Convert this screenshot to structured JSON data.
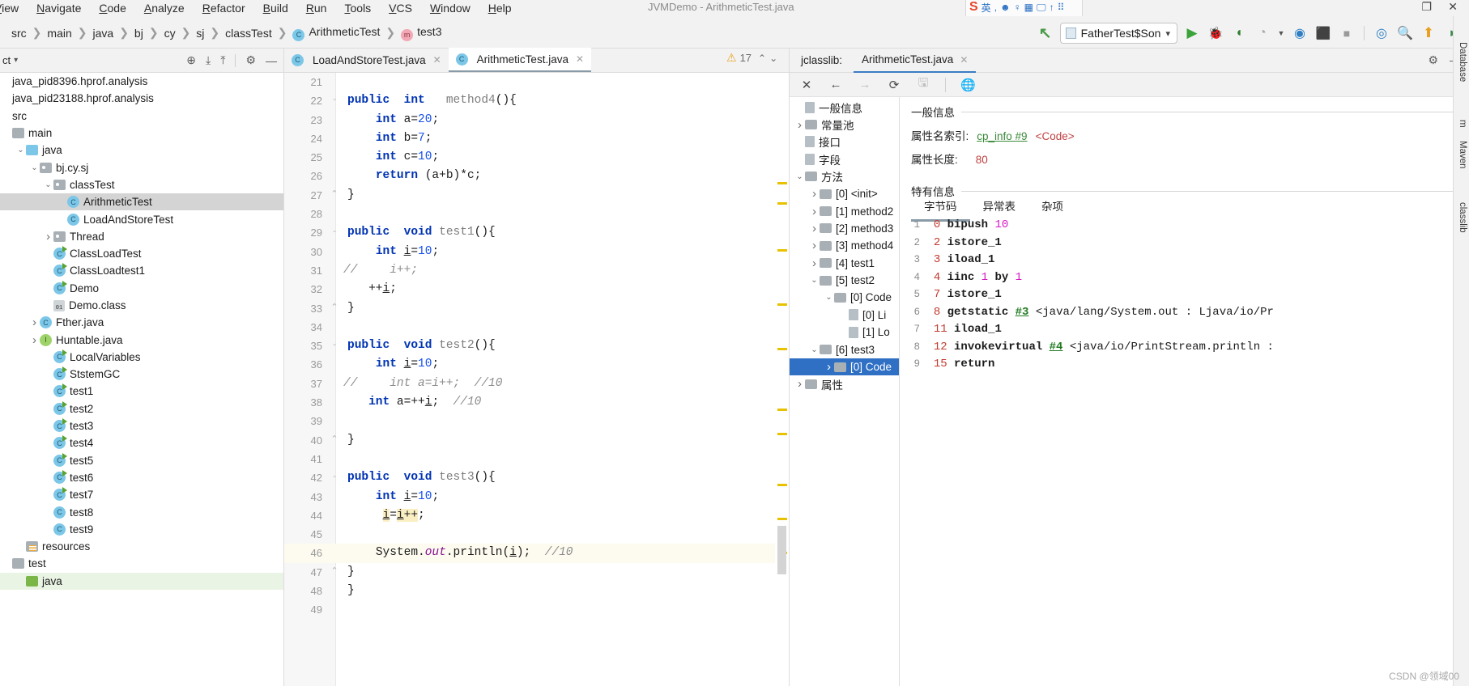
{
  "window": {
    "title": "JVMDemo - ArithmeticTest.java"
  },
  "menubar": {
    "items": [
      "View",
      "Navigate",
      "Code",
      "Analyze",
      "Refactor",
      "Build",
      "Run",
      "Tools",
      "VCS",
      "Window",
      "Help"
    ]
  },
  "ime": {
    "logo": "S",
    "items": [
      "英",
      ",",
      "◐",
      "♀",
      "▦",
      "🖵",
      "↑",
      "⠿"
    ]
  },
  "window_buttons": {
    "restore": "❐",
    "close": "✕"
  },
  "breadcrumb": {
    "items": [
      {
        "label": "src",
        "icon": null
      },
      {
        "label": "main",
        "icon": null
      },
      {
        "label": "java",
        "icon": null
      },
      {
        "label": "bj",
        "icon": null
      },
      {
        "label": "cy",
        "icon": null
      },
      {
        "label": "sj",
        "icon": null
      },
      {
        "label": "classTest",
        "icon": null
      },
      {
        "label": "ArithmeticTest",
        "icon": "class-icon",
        "icon_letter": "C"
      },
      {
        "label": "test3",
        "icon": "method-icon",
        "icon_letter": "m"
      }
    ],
    "separator": "❯"
  },
  "toolbar": {
    "back_label": "↖",
    "run_config": "FatherTest$Son",
    "dropdown_caret": "▾",
    "buttons": [
      {
        "name": "run-button",
        "glyph": "▶",
        "color": "#3aa33a"
      },
      {
        "name": "debug-button",
        "glyph": "🐞",
        "color": "#3a7a3a"
      },
      {
        "name": "run-coverage-button",
        "glyph": "◖",
        "color": "#3a7a3a"
      },
      {
        "name": "profile-button",
        "glyph": "◔",
        "color": "#9a9a9a"
      },
      {
        "name": "profile-dropdown-caret",
        "glyph": "▾",
        "color": "#555"
      },
      {
        "name": "attach-profiler-button",
        "glyph": "◉",
        "color": "#2f7fc4"
      },
      {
        "name": "stop-gradle-button",
        "glyph": "◙",
        "color": "#c03a3a"
      },
      {
        "name": "stop-button",
        "glyph": "■",
        "color": "#8a8a8a"
      },
      {
        "name": "profiler-icon",
        "glyph": "◎",
        "color": "#2f7fc4"
      },
      {
        "name": "search-icon",
        "glyph": "🔍",
        "color": "#4a4a4a"
      },
      {
        "name": "update-project-button",
        "glyph": "⬆",
        "color": "#e8a020"
      },
      {
        "name": "open-button",
        "glyph": "◗",
        "color": "#3a8a4a"
      }
    ]
  },
  "project_panel": {
    "title": "ct",
    "title_caret": "▾",
    "header_icons": [
      "locate-icon",
      "expand-all-icon",
      "collapse-all-icon",
      "gear-icon",
      "minimize-icon"
    ],
    "tree": [
      {
        "depth": 0,
        "arrow": "",
        "icon": "none",
        "label": "java_pid8396.hprof.analysis",
        "state": "normal"
      },
      {
        "depth": 0,
        "arrow": "",
        "icon": "none",
        "label": "java_pid23188.hprof.analysis",
        "state": "normal"
      },
      {
        "depth": 0,
        "arrow": "",
        "icon": "none",
        "label": "src",
        "state": "normal"
      },
      {
        "depth": 0,
        "arrow": "",
        "icon": "folder-gray",
        "label": "main",
        "state": "normal"
      },
      {
        "depth": 1,
        "arrow": "v",
        "icon": "folder-cyan",
        "label": "java",
        "state": "normal"
      },
      {
        "depth": 2,
        "arrow": "v",
        "icon": "package",
        "label": "bj.cy.sj",
        "state": "normal"
      },
      {
        "depth": 3,
        "arrow": "v",
        "icon": "package",
        "label": "classTest",
        "state": "normal"
      },
      {
        "depth": 4,
        "arrow": "",
        "icon": "class",
        "label": "ArithmeticTest",
        "state": "selected"
      },
      {
        "depth": 4,
        "arrow": "",
        "icon": "class",
        "label": "LoadAndStoreTest",
        "state": "normal"
      },
      {
        "depth": 3,
        "arrow": ">",
        "icon": "package",
        "label": "Thread",
        "state": "normal"
      },
      {
        "depth": 3,
        "arrow": "",
        "icon": "class-run",
        "label": "ClassLoadTest",
        "state": "normal"
      },
      {
        "depth": 3,
        "arrow": "",
        "icon": "class-run",
        "label": "ClassLoadtest1",
        "state": "normal"
      },
      {
        "depth": 3,
        "arrow": "",
        "icon": "class-run",
        "label": "Demo",
        "state": "normal"
      },
      {
        "depth": 3,
        "arrow": "",
        "icon": "classfile",
        "label": "Demo.class",
        "state": "normal"
      },
      {
        "depth": 2,
        "arrow": ">",
        "icon": "class",
        "label": "Fther.java",
        "state": "normal"
      },
      {
        "depth": 2,
        "arrow": ">",
        "icon": "interface",
        "label": "Huntable.java",
        "state": "normal"
      },
      {
        "depth": 3,
        "arrow": "",
        "icon": "class-run",
        "label": "LocalVariables",
        "state": "normal"
      },
      {
        "depth": 3,
        "arrow": "",
        "icon": "class-run",
        "label": "StstemGC",
        "state": "normal"
      },
      {
        "depth": 3,
        "arrow": "",
        "icon": "class-run",
        "label": "test1",
        "state": "normal"
      },
      {
        "depth": 3,
        "arrow": "",
        "icon": "class-run",
        "label": "test2",
        "state": "normal"
      },
      {
        "depth": 3,
        "arrow": "",
        "icon": "class-run",
        "label": "test3",
        "state": "normal"
      },
      {
        "depth": 3,
        "arrow": "",
        "icon": "class-run",
        "label": "test4",
        "state": "normal"
      },
      {
        "depth": 3,
        "arrow": "",
        "icon": "class-run",
        "label": "test5",
        "state": "normal"
      },
      {
        "depth": 3,
        "arrow": "",
        "icon": "class-run",
        "label": "test6",
        "state": "normal"
      },
      {
        "depth": 3,
        "arrow": "",
        "icon": "class-run",
        "label": "test7",
        "state": "normal"
      },
      {
        "depth": 3,
        "arrow": "",
        "icon": "class",
        "label": "test8",
        "state": "normal"
      },
      {
        "depth": 3,
        "arrow": "",
        "icon": "class",
        "label": "test9",
        "state": "normal"
      },
      {
        "depth": 1,
        "arrow": "",
        "icon": "resources",
        "label": "resources",
        "state": "normal"
      },
      {
        "depth": 0,
        "arrow": "",
        "icon": "folder-gray",
        "label": "test",
        "state": "normal"
      },
      {
        "depth": 1,
        "arrow": "",
        "icon": "folder-green",
        "label": "java",
        "state": "green"
      }
    ]
  },
  "editor": {
    "tabs": [
      {
        "label": "LoadAndStoreTest.java",
        "active": false,
        "close": "✕",
        "icon_letter": "C"
      },
      {
        "label": "ArithmeticTest.java",
        "active": true,
        "close": "✕",
        "icon_letter": "C"
      }
    ],
    "inspection_badge": {
      "glyph": "⚠",
      "count": "17",
      "up": "⌃",
      "down": "⌄"
    },
    "first_line_number": 21,
    "lines": [
      {
        "n": 21,
        "fold": "",
        "prefix": "",
        "html": "",
        "hl": false
      },
      {
        "n": 22,
        "fold": "-",
        "prefix": "",
        "html": "<span class='kw'>public</span>  <span class='kw'>int</span>   <span class='mname'>method4</span><span class='plain'>(){</span>",
        "hl": false
      },
      {
        "n": 23,
        "fold": "",
        "prefix": "",
        "html": "    <span class='kw'>int</span> <span class='plain'>a=</span><span class='num'>20</span><span class='plain'>;</span>",
        "hl": false
      },
      {
        "n": 24,
        "fold": "",
        "prefix": "",
        "html": "    <span class='kw'>int</span> <span class='plain'>b=</span><span class='num'>7</span><span class='plain'>;</span>",
        "hl": false
      },
      {
        "n": 25,
        "fold": "",
        "prefix": "",
        "html": "    <span class='kw'>int</span> <span class='plain'>c=</span><span class='num'>10</span><span class='plain'>;</span>",
        "hl": false
      },
      {
        "n": 26,
        "fold": "",
        "prefix": "",
        "html": "    <span class='kw'>return</span> <span class='plain'>(a+b)*c;</span>",
        "hl": false
      },
      {
        "n": 27,
        "fold": "⌃",
        "prefix": "",
        "html": "<span class='plain'>}</span>",
        "hl": false
      },
      {
        "n": 28,
        "fold": "",
        "prefix": "",
        "html": "",
        "hl": false
      },
      {
        "n": 29,
        "fold": "-",
        "prefix": "",
        "html": "<span class='kw'>public</span>  <span class='kw'>void</span> <span class='mname'>test1</span><span class='plain'>(){</span>",
        "hl": false
      },
      {
        "n": 30,
        "fold": "",
        "prefix": "",
        "html": "    <span class='kw'>int</span> <span class='plain und'>i</span><span class='plain'>=</span><span class='num'>10</span><span class='plain'>;</span>",
        "hl": false
      },
      {
        "n": 31,
        "fold": "",
        "prefix": "//",
        "html": "      <span class='cmt'>i++;</span>",
        "hl": false
      },
      {
        "n": 32,
        "fold": "",
        "prefix": "",
        "html": "   <span class='plain'>++</span><span class='plain und'>i</span><span class='plain'>;</span>",
        "hl": false
      },
      {
        "n": 33,
        "fold": "⌃",
        "prefix": "",
        "html": "<span class='plain'>}</span>",
        "hl": false
      },
      {
        "n": 34,
        "fold": "",
        "prefix": "",
        "html": "",
        "hl": false
      },
      {
        "n": 35,
        "fold": "-",
        "prefix": "",
        "html": "<span class='kw'>public</span>  <span class='kw'>void</span> <span class='mname'>test2</span><span class='plain'>(){</span>",
        "hl": false
      },
      {
        "n": 36,
        "fold": "",
        "prefix": "",
        "html": "    <span class='kw'>int</span> <span class='plain und'>i</span><span class='plain'>=</span><span class='num'>10</span><span class='plain'>;</span>",
        "hl": false
      },
      {
        "n": 37,
        "fold": "",
        "prefix": "//",
        "html": "      <span class='cmt'>int a=i++;  //10</span>",
        "hl": false
      },
      {
        "n": 38,
        "fold": "",
        "prefix": "",
        "html": "   <span class='kw'>int</span> <span class='plain'>a=++</span><span class='plain und'>i</span><span class='plain'>;  </span><span class='cmt'>//10</span>",
        "hl": false
      },
      {
        "n": 39,
        "fold": "",
        "prefix": "",
        "html": "",
        "hl": false
      },
      {
        "n": 40,
        "fold": "⌃",
        "prefix": "",
        "html": "<span class='plain'>}</span>",
        "hl": false
      },
      {
        "n": 41,
        "fold": "",
        "prefix": "",
        "html": "",
        "hl": false
      },
      {
        "n": 42,
        "fold": "-",
        "prefix": "",
        "html": "<span class='kw'>public</span>  <span class='kw'>void</span> <span class='mname'>test3</span><span class='plain'>(){</span>",
        "hl": false
      },
      {
        "n": 43,
        "fold": "",
        "prefix": "",
        "html": "    <span class='kw'>int</span> <span class='plain und'>i</span><span class='plain'>=</span><span class='num'>10</span><span class='plain'>;</span>",
        "hl": false
      },
      {
        "n": 44,
        "fold": "",
        "prefix": "",
        "html": "     <span class='mark und'>i</span><span class='plain'>=</span><span class='mark und'>i</span><span class='mark'>++</span><span class='plain'>;</span>",
        "hl": false
      },
      {
        "n": 45,
        "fold": "",
        "prefix": "",
        "html": "",
        "hl": false
      },
      {
        "n": 46,
        "fold": "",
        "prefix": "",
        "html": "    <span class='plain'>System.</span><span class='fld'>out</span><span class='plain'>.println(</span><span class='plain und'>i</span><span class='plain'>);  </span><span class='cmt'>//10</span>",
        "hl": true
      },
      {
        "n": 47,
        "fold": "⌃",
        "prefix": "",
        "html": "<span class='plain'>}</span>",
        "hl": false
      },
      {
        "n": 48,
        "fold": "",
        "prefix": "",
        "html": "<span class='plain'>}</span>",
        "hl": false
      },
      {
        "n": 49,
        "fold": "",
        "prefix": "",
        "html": "",
        "hl": false
      }
    ]
  },
  "jclasslib": {
    "panel_label": "jclasslib:",
    "tab": {
      "label": "ArithmeticTest.java",
      "close": "✕"
    },
    "header_icons": [
      "gear-icon",
      "minimize-icon"
    ],
    "toolbar_icons": [
      {
        "name": "close-icon",
        "glyph": "✕",
        "disabled": false
      },
      {
        "name": "back-arrow-icon",
        "glyph": "←",
        "disabled": false
      },
      {
        "name": "forward-arrow-icon",
        "glyph": "→",
        "disabled": true
      },
      {
        "name": "reload-icon",
        "glyph": "⟳",
        "disabled": false
      },
      {
        "name": "save-icon",
        "glyph": "🖫",
        "disabled": true
      },
      {
        "name": "browse-icon",
        "glyph": "🌐",
        "disabled": false
      }
    ],
    "tree": [
      {
        "depth": 0,
        "arrow": "",
        "icon": "file",
        "label": "一般信息",
        "state": "normal"
      },
      {
        "depth": 0,
        "arrow": ">",
        "icon": "folder",
        "label": "常量池",
        "state": "normal"
      },
      {
        "depth": 0,
        "arrow": "",
        "icon": "file",
        "label": "接口",
        "state": "normal"
      },
      {
        "depth": 0,
        "arrow": "",
        "icon": "file",
        "label": "字段",
        "state": "normal"
      },
      {
        "depth": 0,
        "arrow": "v",
        "icon": "folder",
        "label": "方法",
        "state": "normal"
      },
      {
        "depth": 1,
        "arrow": ">",
        "icon": "folder",
        "label": "[0] <init>",
        "state": "normal"
      },
      {
        "depth": 1,
        "arrow": ">",
        "icon": "folder",
        "label": "[1] method2",
        "state": "normal"
      },
      {
        "depth": 1,
        "arrow": ">",
        "icon": "folder",
        "label": "[2] method3",
        "state": "normal"
      },
      {
        "depth": 1,
        "arrow": ">",
        "icon": "folder",
        "label": "[3] method4",
        "state": "normal"
      },
      {
        "depth": 1,
        "arrow": ">",
        "icon": "folder",
        "label": "[4] test1",
        "state": "normal"
      },
      {
        "depth": 1,
        "arrow": "v",
        "icon": "folder",
        "label": "[5] test2",
        "state": "normal"
      },
      {
        "depth": 2,
        "arrow": "v",
        "icon": "folder",
        "label": "[0] Code",
        "state": "normal"
      },
      {
        "depth": 3,
        "arrow": "",
        "icon": "file",
        "label": "[0] Li",
        "state": "normal"
      },
      {
        "depth": 3,
        "arrow": "",
        "icon": "file",
        "label": "[1] Lo",
        "state": "normal"
      },
      {
        "depth": 1,
        "arrow": "v",
        "icon": "folder",
        "label": "[6] test3",
        "state": "normal"
      },
      {
        "depth": 2,
        "arrow": ">",
        "icon": "folder",
        "label": "[0] Code",
        "state": "selected"
      },
      {
        "depth": 0,
        "arrow": ">",
        "icon": "folder",
        "label": "属性",
        "state": "normal"
      }
    ],
    "detail": {
      "general_section": "一般信息",
      "rows": [
        {
          "key": "属性名索引:",
          "link": "cp_info #9",
          "extra": "<Code>"
        },
        {
          "key": "属性长度:",
          "value": "80"
        }
      ],
      "specific_section": "特有信息",
      "subtabs": [
        {
          "label": "字节码",
          "active": true
        },
        {
          "label": "异常表",
          "active": false
        },
        {
          "label": "杂项",
          "active": false
        }
      ],
      "bytecode": [
        {
          "idx": "1",
          "offset": "0",
          "op": "bipush",
          "imm": "10",
          "ref": "",
          "desc": ""
        },
        {
          "idx": "2",
          "offset": "2",
          "op": "istore_1",
          "imm": "",
          "ref": "",
          "desc": ""
        },
        {
          "idx": "3",
          "offset": "3",
          "op": "iload_1",
          "imm": "",
          "ref": "",
          "desc": ""
        },
        {
          "idx": "4",
          "offset": "4",
          "op": "iinc",
          "imm": "1",
          "op2": "by",
          "imm2": "1",
          "ref": "",
          "desc": ""
        },
        {
          "idx": "5",
          "offset": "7",
          "op": "istore_1",
          "imm": "",
          "ref": "",
          "desc": ""
        },
        {
          "idx": "6",
          "offset": "8",
          "op": "getstatic",
          "imm": "",
          "ref": "#3",
          "desc": "<java/lang/System.out : Ljava/io/Pr"
        },
        {
          "idx": "7",
          "offset": "11",
          "op": "iload_1",
          "imm": "",
          "ref": "",
          "desc": ""
        },
        {
          "idx": "8",
          "offset": "12",
          "op": "invokevirtual",
          "imm": "",
          "ref": "#4",
          "desc": "<java/io/PrintStream.println :"
        },
        {
          "idx": "9",
          "offset": "15",
          "op": "return",
          "imm": "",
          "ref": "",
          "desc": ""
        }
      ]
    }
  },
  "right_strip": {
    "labels": [
      "Database",
      "m",
      "Maven",
      "classlib"
    ]
  },
  "watermark": "CSDN @领域00"
}
